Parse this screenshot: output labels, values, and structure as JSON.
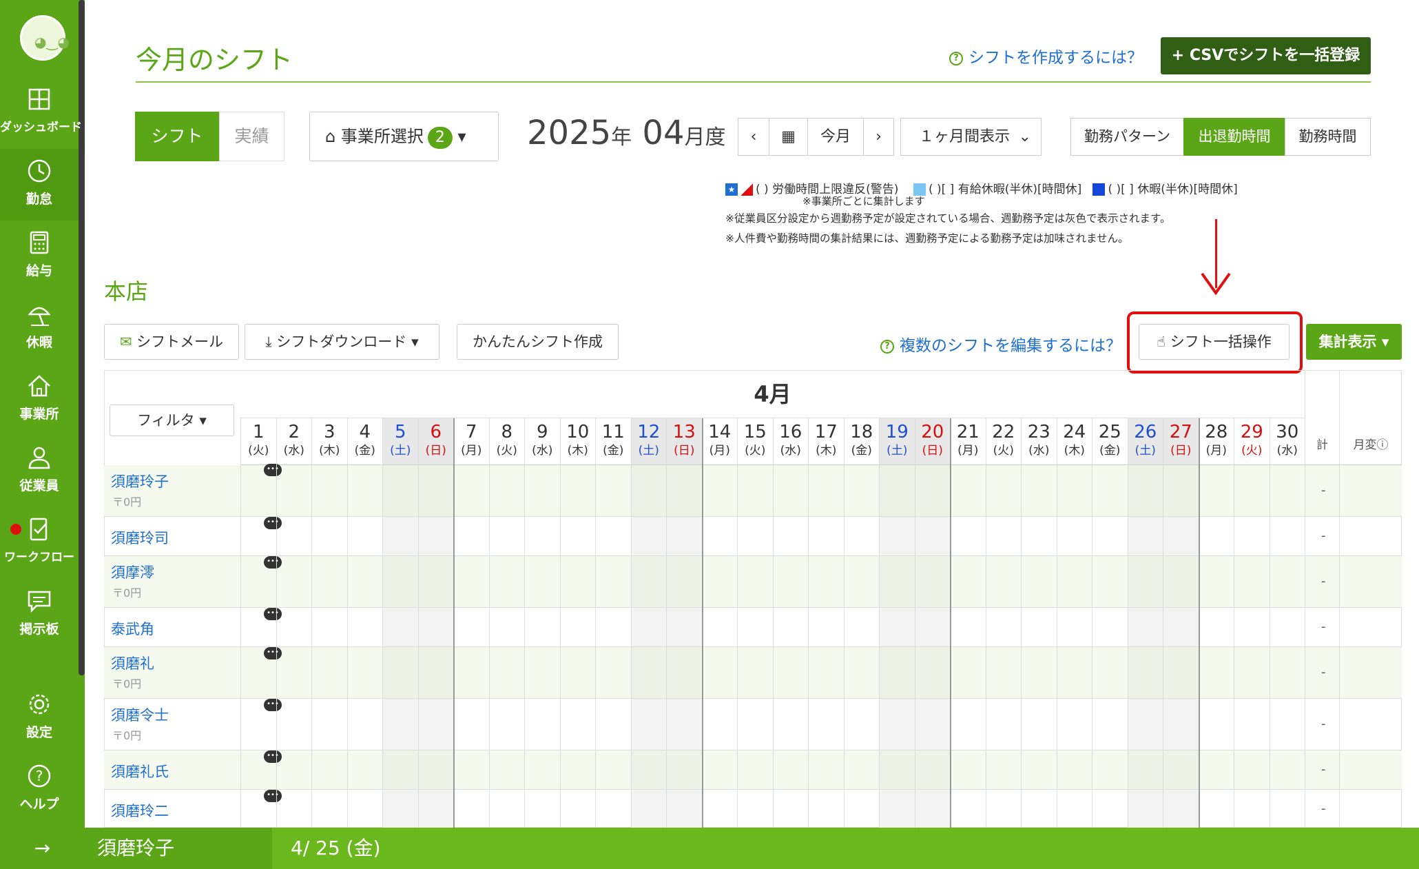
{
  "nav": {
    "items": [
      {
        "label": "ダッシュボード"
      },
      {
        "label": "勤怠"
      },
      {
        "label": "給与"
      },
      {
        "label": "休暇"
      },
      {
        "label": "事業所"
      },
      {
        "label": "従業員"
      },
      {
        "label": "ワークフロー"
      },
      {
        "label": "掲示板"
      },
      {
        "label": "設定"
      },
      {
        "label": "ヘルプ"
      }
    ],
    "collapse": "→"
  },
  "header": {
    "title": "今月のシフト",
    "help_link": "シフトを作成するには？",
    "csv_button": "+ CSVでシフトを一括登録"
  },
  "toolbar": {
    "tab_shift": "シフト",
    "tab_actual": "実績",
    "office_select": "事業所選択",
    "office_count": "2",
    "year": "2025",
    "year_suffix": "年",
    "month": "04",
    "month_suffix": "月度",
    "prev": "‹",
    "calendar_icon": "▦",
    "today": "今月",
    "next": "›",
    "range_select": "１ヶ月間表示",
    "mode_pattern": "勤務パターン",
    "mode_inout": "出退勤時間",
    "mode_worktime": "勤務時間"
  },
  "legend": {
    "item1": "( ) 労働時間上限違反(警告)",
    "item1_sub": "※事業所ごとに集計します",
    "item2": "( )[ ] 有給休暇(半休)[時間休]",
    "item3": "( )[ ] 休暇(半休)[時間休]",
    "note1": "※従業員区分設定から週勤務予定が設定されている場合、週勤務予定は灰色で表示されます。",
    "note2": "※人件費や勤務時間の集計結果には、週勤務予定による勤務予定は加味されません。",
    "colors": {
      "warn": "#e01010",
      "paid": "#7cc6f3",
      "leave": "#1546d8"
    }
  },
  "store": {
    "name": "本店",
    "btn_mail": "シフトメール",
    "btn_download": "シフトダウンロード",
    "btn_easy": "かんたんシフト作成",
    "help_multi": "複数のシフトを編集するには？",
    "btn_bulk": "シフト一括操作",
    "btn_aggregate": "集計表示"
  },
  "grid": {
    "month_label": "4月",
    "filter": "フィルタ",
    "total_header": "計",
    "change_header": "月変",
    "days": [
      {
        "d": "1",
        "w": "(火)",
        "t": ""
      },
      {
        "d": "2",
        "w": "(水)",
        "t": ""
      },
      {
        "d": "3",
        "w": "(木)",
        "t": ""
      },
      {
        "d": "4",
        "w": "(金)",
        "t": ""
      },
      {
        "d": "5",
        "w": "(土)",
        "t": "sat"
      },
      {
        "d": "6",
        "w": "(日)",
        "t": "sun"
      },
      {
        "d": "7",
        "w": "(月)",
        "t": ""
      },
      {
        "d": "8",
        "w": "(火)",
        "t": ""
      },
      {
        "d": "9",
        "w": "(水)",
        "t": ""
      },
      {
        "d": "10",
        "w": "(木)",
        "t": ""
      },
      {
        "d": "11",
        "w": "(金)",
        "t": ""
      },
      {
        "d": "12",
        "w": "(土)",
        "t": "sat"
      },
      {
        "d": "13",
        "w": "(日)",
        "t": "sun"
      },
      {
        "d": "14",
        "w": "(月)",
        "t": ""
      },
      {
        "d": "15",
        "w": "(火)",
        "t": ""
      },
      {
        "d": "16",
        "w": "(水)",
        "t": ""
      },
      {
        "d": "17",
        "w": "(木)",
        "t": ""
      },
      {
        "d": "18",
        "w": "(金)",
        "t": ""
      },
      {
        "d": "19",
        "w": "(土)",
        "t": "sat"
      },
      {
        "d": "20",
        "w": "(日)",
        "t": "sun"
      },
      {
        "d": "21",
        "w": "(月)",
        "t": ""
      },
      {
        "d": "22",
        "w": "(火)",
        "t": ""
      },
      {
        "d": "23",
        "w": "(水)",
        "t": ""
      },
      {
        "d": "24",
        "w": "(木)",
        "t": ""
      },
      {
        "d": "25",
        "w": "(金)",
        "t": ""
      },
      {
        "d": "26",
        "w": "(土)",
        "t": "sat"
      },
      {
        "d": "27",
        "w": "(日)",
        "t": "sun"
      },
      {
        "d": "28",
        "w": "(月)",
        "t": ""
      },
      {
        "d": "29",
        "w": "(火)",
        "t": "hol"
      },
      {
        "d": "30",
        "w": "(水)",
        "t": ""
      }
    ],
    "employees": [
      {
        "name": "須磨玲子",
        "sub": "〒0円",
        "total": "-"
      },
      {
        "name": "須磨玲司",
        "sub": "",
        "total": "-"
      },
      {
        "name": "須摩澪",
        "sub": "〒0円",
        "total": "-"
      },
      {
        "name": "泰武角",
        "sub": "",
        "total": "-"
      },
      {
        "name": "須磨礼",
        "sub": "〒0円",
        "total": "-"
      },
      {
        "name": "須磨令士",
        "sub": "〒0円",
        "total": "-"
      },
      {
        "name": "須磨礼氏",
        "sub": "",
        "total": "-"
      },
      {
        "name": "須磨玲二",
        "sub": "",
        "total": "-"
      }
    ]
  },
  "footer": {
    "selected_employee": "須磨玲子",
    "selected_date": "4/ 25 (金)"
  }
}
